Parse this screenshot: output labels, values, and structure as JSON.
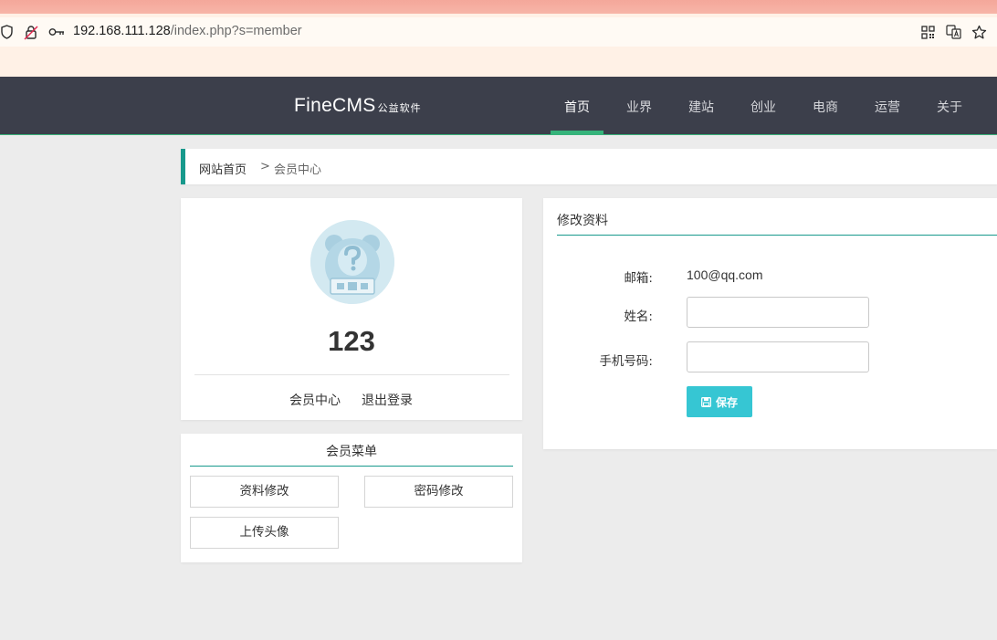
{
  "browser": {
    "url_host": "192.168.111.128",
    "url_path": "/index.php?s=member"
  },
  "site": {
    "logo_main": "FineCMS",
    "logo_sub": "公益软件",
    "nav": [
      {
        "label": "首页",
        "active": true
      },
      {
        "label": "业界"
      },
      {
        "label": "建站"
      },
      {
        "label": "创业"
      },
      {
        "label": "电商"
      },
      {
        "label": "运营"
      },
      {
        "label": "关于"
      }
    ]
  },
  "breadcrumb": {
    "home": "网站首页",
    "sep": ">",
    "current": "会员中心"
  },
  "profile": {
    "username": "123",
    "links": [
      "会员中心",
      "退出登录"
    ]
  },
  "member_menu": {
    "title": "会员菜单",
    "items": [
      "资料修改",
      "密码修改",
      "上传头像"
    ]
  },
  "edit": {
    "title": "修改资料",
    "email_label": "邮箱:",
    "email_value": "100@qq.com",
    "name_label": "姓名:",
    "name_value": "",
    "phone_label": "手机号码:",
    "phone_value": "",
    "save_label": "保存"
  },
  "colors": {
    "nav_bg": "#3c3f4b",
    "accent_teal": "#17998c",
    "nav_active_bar": "#35b37a",
    "save_button": "#36c6d3"
  }
}
